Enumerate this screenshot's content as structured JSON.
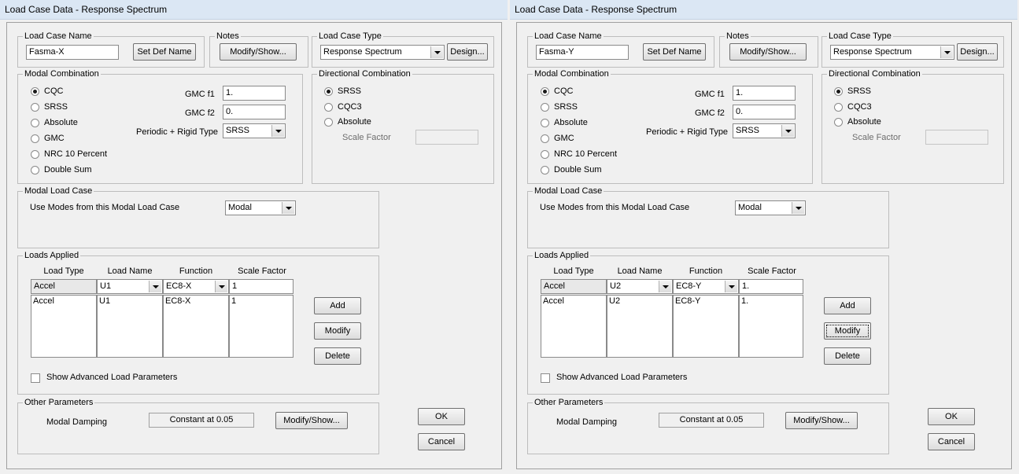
{
  "windows": [
    {
      "title": "Load Case Data - Response Spectrum",
      "groups": {
        "load_case_name": "Load Case Name",
        "notes": "Notes",
        "load_case_type": "Load Case Type",
        "modal_combination": "Modal Combination",
        "directional_combination": "Directional Combination",
        "modal_load_case": "Modal Load Case",
        "loads_applied": "Loads Applied",
        "other_parameters": "Other Parameters"
      },
      "load_case_name_value": "Fasma-X",
      "set_def_name_label": "Set Def Name",
      "notes_button_label": "Modify/Show...",
      "load_case_type_value": "Response Spectrum",
      "design_button_label": "Design...",
      "modal_options": [
        "CQC",
        "SRSS",
        "Absolute",
        "GMC",
        "NRC 10 Percent",
        "Double Sum"
      ],
      "modal_selected": "CQC",
      "gmc_f1_label": "GMC  f1",
      "gmc_f1_value": "1.",
      "gmc_f2_label": "GMC  f2",
      "gmc_f2_value": "0.",
      "periodic_label": "Periodic + Rigid Type",
      "periodic_value": "SRSS",
      "directional_options": [
        "SRSS",
        "CQC3",
        "Absolute"
      ],
      "directional_selected": "SRSS",
      "scale_factor_label": "Scale Factor",
      "scale_factor_value": "",
      "use_modes_label": "Use Modes from this Modal Load Case",
      "use_modes_value": "Modal",
      "loads_headers": [
        "Load Type",
        "Load Name",
        "Function",
        "Scale Factor"
      ],
      "edit_row": {
        "load_type": "Accel",
        "load_name": "U1",
        "function": "EC8-X",
        "scale_factor": "1"
      },
      "list_row": {
        "load_type": "Accel",
        "load_name": "U1",
        "function": "EC8-X",
        "scale_factor": "1"
      },
      "add_label": "Add",
      "modify_label": "Modify",
      "delete_label": "Delete",
      "show_advanced_label": "Show Advanced Load Parameters",
      "modal_damping_label": "Modal Damping",
      "modal_damping_value": "Constant at 0.05",
      "damping_button_label": "Modify/Show...",
      "ok_label": "OK",
      "cancel_label": "Cancel"
    },
    {
      "title": "Load Case Data - Response Spectrum",
      "groups": {
        "load_case_name": "Load Case Name",
        "notes": "Notes",
        "load_case_type": "Load Case Type",
        "modal_combination": "Modal Combination",
        "directional_combination": "Directional Combination",
        "modal_load_case": "Modal Load Case",
        "loads_applied": "Loads Applied",
        "other_parameters": "Other Parameters"
      },
      "load_case_name_value": "Fasma-Y",
      "set_def_name_label": "Set Def Name",
      "notes_button_label": "Modify/Show...",
      "load_case_type_value": "Response Spectrum",
      "design_button_label": "Design...",
      "modal_options": [
        "CQC",
        "SRSS",
        "Absolute",
        "GMC",
        "NRC 10 Percent",
        "Double Sum"
      ],
      "modal_selected": "CQC",
      "gmc_f1_label": "GMC  f1",
      "gmc_f1_value": "1.",
      "gmc_f2_label": "GMC  f2",
      "gmc_f2_value": "0.",
      "periodic_label": "Periodic + Rigid Type",
      "periodic_value": "SRSS",
      "directional_options": [
        "SRSS",
        "CQC3",
        "Absolute"
      ],
      "directional_selected": "SRSS",
      "scale_factor_label": "Scale Factor",
      "scale_factor_value": "",
      "use_modes_label": "Use Modes from this Modal Load Case",
      "use_modes_value": "Modal",
      "loads_headers": [
        "Load Type",
        "Load Name",
        "Function",
        "Scale Factor"
      ],
      "edit_row": {
        "load_type": "Accel",
        "load_name": "U2",
        "function": "EC8-Y",
        "scale_factor": "1."
      },
      "list_row": {
        "load_type": "Accel",
        "load_name": "U2",
        "function": "EC8-Y",
        "scale_factor": "1."
      },
      "add_label": "Add",
      "modify_label": "Modify",
      "delete_label": "Delete",
      "show_advanced_label": "Show Advanced Load Parameters",
      "modal_damping_label": "Modal Damping",
      "modal_damping_value": "Constant at 0.05",
      "damping_button_label": "Modify/Show...",
      "ok_label": "OK",
      "cancel_label": "Cancel"
    }
  ]
}
